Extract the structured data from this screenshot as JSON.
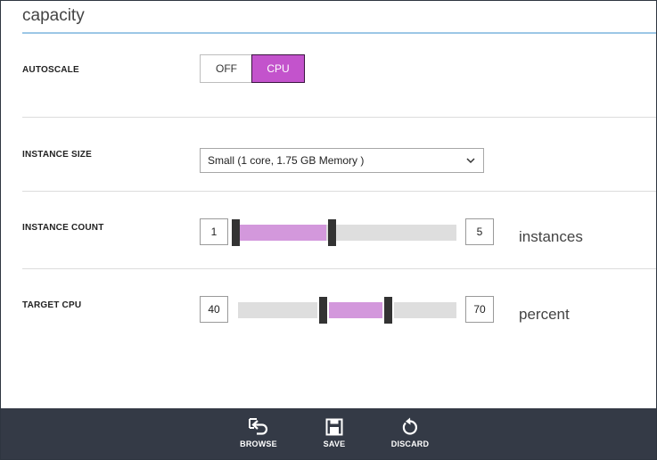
{
  "section": {
    "title": "capacity"
  },
  "autoscale": {
    "label": "AUTOSCALE",
    "options": [
      "OFF",
      "CPU"
    ],
    "selected": "CPU"
  },
  "instance_size": {
    "label": "INSTANCE SIZE",
    "selected": "Small (1 core, 1.75 GB Memory )"
  },
  "instance_count": {
    "label": "INSTANCE COUNT",
    "min": "1",
    "max": "5",
    "unit": "instances"
  },
  "target_cpu": {
    "label": "TARGET CPU",
    "min": "40",
    "max": "70",
    "unit": "percent"
  },
  "command_bar": {
    "browse": {
      "label": "BROWSE",
      "icon": "browse-icon"
    },
    "save": {
      "label": "SAVE",
      "icon": "save-icon"
    },
    "discard": {
      "label": "DISCARD",
      "icon": "discard-icon"
    }
  },
  "colors": {
    "accent": "#c353cc",
    "slider_fill": "#d398dc",
    "command_bar": "#343a46",
    "title_rule": "#9cc7e6"
  }
}
